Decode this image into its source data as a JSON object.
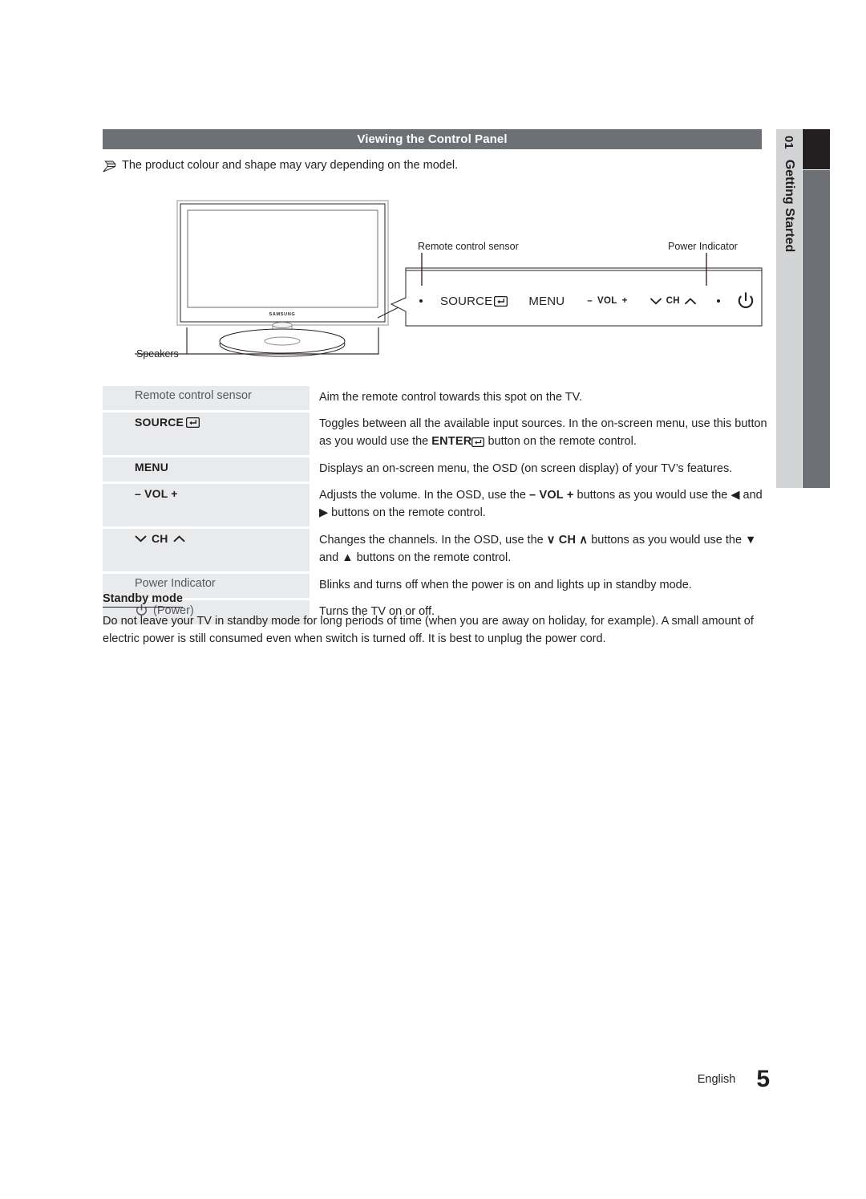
{
  "side_tab": {
    "number": "01",
    "label": "Getting Started",
    "colors": {
      "light": "#d2d3d5",
      "dark": "#231f20",
      "gray": "#6d7074"
    }
  },
  "section": {
    "title": "Viewing the Control Panel",
    "header_bg": "#6d7074",
    "note_icon": "pencil-note-icon",
    "note": "The product colour and shape may vary depending on the model."
  },
  "diagram": {
    "brand": "SAMSUNG",
    "labels": {
      "speakers": "Speakers",
      "remote_control_sensor": "Remote control sensor",
      "power_indicator": "Power Indicator"
    },
    "control_panel": {
      "source": "SOURCE",
      "source_icon": "enter-return-icon",
      "menu": "MENU",
      "vol_minus": "–",
      "vol": "VOL",
      "vol_plus": "+",
      "ch_down_icon": "chevron-down-icon",
      "ch": "CH",
      "ch_up_icon": "chevron-up-icon",
      "power_icon": "power-icon",
      "sensor_dot": "sensor-dot",
      "indicator_dot": "indicator-dot"
    }
  },
  "spec_table": {
    "rows": [
      {
        "term": "Remote control sensor",
        "term_style": "normal",
        "desc_parts": [
          {
            "t": "Aim the remote control towards this spot on the TV."
          }
        ]
      },
      {
        "term": "SOURCE",
        "term_style": "bold",
        "term_icon": "enter-return-icon",
        "desc_parts": [
          {
            "t": "Toggles between all the available input sources. In the on-screen menu, use this button as you would use the "
          },
          {
            "t": "ENTER",
            "b": true
          },
          {
            "icon": "enter-return-icon"
          },
          {
            "t": " button on the remote control."
          }
        ]
      },
      {
        "term": "MENU",
        "term_style": "bold",
        "desc_parts": [
          {
            "t": "Displays an on-screen menu, the OSD (on screen display) of your TV’s features."
          }
        ]
      },
      {
        "term": "– VOL +",
        "term_style": "bold",
        "desc_parts": [
          {
            "t": "Adjusts the volume. In the OSD, use the "
          },
          {
            "t": "– VOL +",
            "b": true
          },
          {
            "t": " buttons as you would use the ◀ and ▶ buttons on the remote control."
          }
        ]
      },
      {
        "term": "CH",
        "term_style": "bold",
        "term_chevrons": true,
        "desc_parts": [
          {
            "t": "Changes the channels. In the OSD, use the "
          },
          {
            "t": "∨ CH ∧",
            "b": true
          },
          {
            "t": " buttons as you would use the ▼ and ▲ buttons on the remote control."
          }
        ]
      },
      {
        "term": "Power Indicator",
        "term_style": "normal",
        "desc_parts": [
          {
            "t": "Blinks and turns off when the power is on and lights up in standby mode."
          }
        ]
      },
      {
        "term": "(Power)",
        "term_style": "normal",
        "term_icon": "power-icon",
        "desc_parts": [
          {
            "t": "Turns the TV on or off."
          }
        ]
      }
    ]
  },
  "standby": {
    "heading": "Standby mode",
    "body": "Do not leave your TV in standby mode for long periods of time (when you are away on holiday, for example). A small amount of electric power is still consumed even when switch is turned off. It is best to unplug the power cord."
  },
  "footer": {
    "language": "English",
    "page_number": "5"
  }
}
